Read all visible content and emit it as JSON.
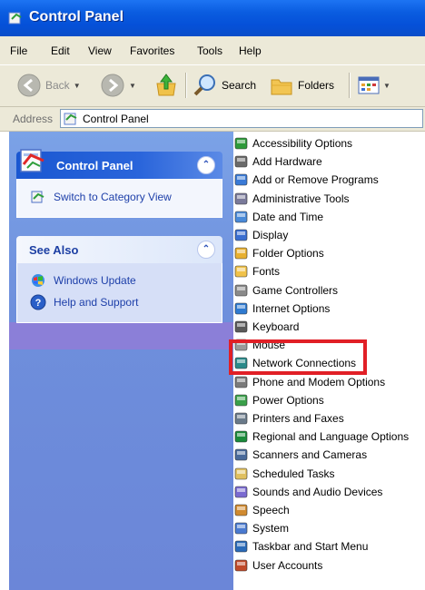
{
  "window": {
    "title": "Control Panel"
  },
  "menu": [
    "File",
    "Edit",
    "View",
    "Favorites",
    "Tools",
    "Help"
  ],
  "toolbar": {
    "back_label": "Back",
    "search_label": "Search",
    "folders_label": "Folders"
  },
  "address": {
    "label": "Address",
    "value": "Control Panel"
  },
  "task_pane": {
    "control_panel_box": {
      "title": "Control Panel",
      "links": [
        "Switch to Category View"
      ]
    },
    "see_also_box": {
      "title": "See Also",
      "links": [
        "Windows Update",
        "Help and Support"
      ]
    }
  },
  "items": [
    {
      "label": "Accessibility Options",
      "icon": "accessibility-icon"
    },
    {
      "label": "Add Hardware",
      "icon": "add-hardware-icon"
    },
    {
      "label": "Add or Remove Programs",
      "icon": "add-remove-programs-icon"
    },
    {
      "label": "Administrative Tools",
      "icon": "administrative-tools-icon"
    },
    {
      "label": "Date and Time",
      "icon": "date-time-icon"
    },
    {
      "label": "Display",
      "icon": "display-icon"
    },
    {
      "label": "Folder Options",
      "icon": "folder-options-icon"
    },
    {
      "label": "Fonts",
      "icon": "fonts-icon"
    },
    {
      "label": "Game Controllers",
      "icon": "game-controllers-icon"
    },
    {
      "label": "Internet Options",
      "icon": "internet-options-icon"
    },
    {
      "label": "Keyboard",
      "icon": "keyboard-icon"
    },
    {
      "label": "Mouse",
      "icon": "mouse-icon"
    },
    {
      "label": "Network Connections",
      "icon": "network-connections-icon"
    },
    {
      "label": "Phone and Modem Options",
      "icon": "phone-modem-icon"
    },
    {
      "label": "Power Options",
      "icon": "power-options-icon"
    },
    {
      "label": "Printers and Faxes",
      "icon": "printers-faxes-icon"
    },
    {
      "label": "Regional and Language Options",
      "icon": "regional-language-icon"
    },
    {
      "label": "Scanners and Cameras",
      "icon": "scanners-cameras-icon"
    },
    {
      "label": "Scheduled Tasks",
      "icon": "scheduled-tasks-icon"
    },
    {
      "label": "Sounds and Audio Devices",
      "icon": "sounds-audio-icon"
    },
    {
      "label": "Speech",
      "icon": "speech-icon"
    },
    {
      "label": "System",
      "icon": "system-icon"
    },
    {
      "label": "Taskbar and Start Menu",
      "icon": "taskbar-start-menu-icon"
    },
    {
      "label": "User Accounts",
      "icon": "user-accounts-icon"
    }
  ],
  "highlighted_item": "Network Connections",
  "colors": {
    "title_bar": "#0a5ce0",
    "task_pane": "#6e8fdc",
    "highlight": "#e11f26",
    "link": "#1d3fa9"
  }
}
